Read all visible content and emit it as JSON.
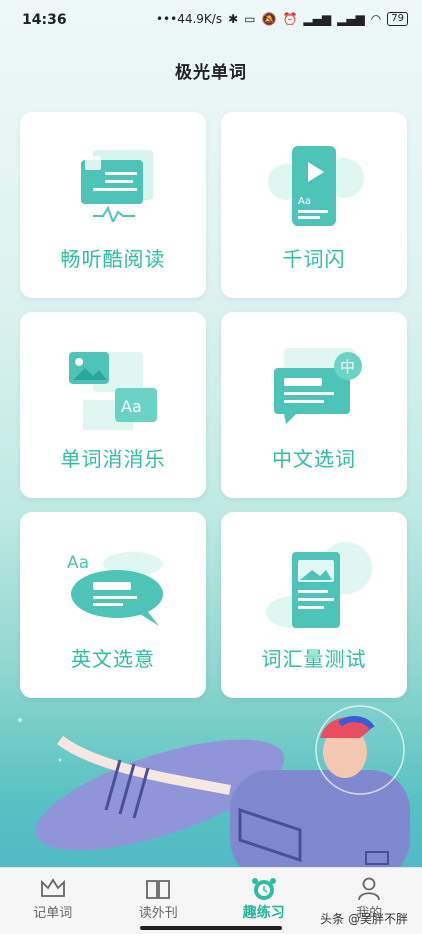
{
  "status_bar": {
    "time": "14:36",
    "network_speed": "44.9K/s",
    "battery": "79"
  },
  "header": {
    "title": "极光单词"
  },
  "cards": [
    {
      "label": "畅听酷阅读",
      "icon": "reading-illustration"
    },
    {
      "label": "千词闪",
      "icon": "phone-play-illustration"
    },
    {
      "label": "单词消消乐",
      "icon": "image-aa-illustration"
    },
    {
      "label": "中文选词",
      "icon": "chinese-chat-illustration"
    },
    {
      "label": "英文选意",
      "icon": "english-bubble-illustration"
    },
    {
      "label": "词汇量测试",
      "icon": "vocab-test-illustration"
    }
  ],
  "tabbar": {
    "items": [
      {
        "label": "记单词",
        "icon": "crown-icon",
        "active": false
      },
      {
        "label": "读外刊",
        "icon": "book-icon",
        "active": false
      },
      {
        "label": "趣练习",
        "icon": "alarm-clock-icon",
        "active": true
      },
      {
        "label": "我的",
        "icon": "person-icon",
        "active": false
      }
    ]
  },
  "watermark": "头条 @吴胖不胖",
  "colors": {
    "accent": "#2dbfa4",
    "tab_active": "#22b59b"
  }
}
